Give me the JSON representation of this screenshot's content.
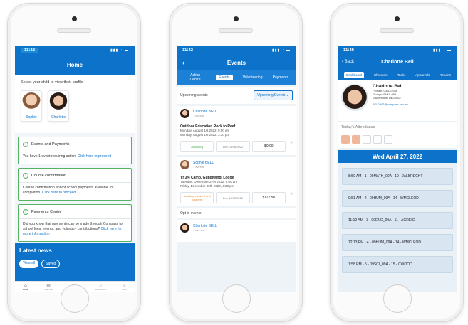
{
  "phone1": {
    "status_time": "11:42",
    "status_icons": "▮▮▮ ◔ ▬",
    "title": "Home",
    "select_label": "Select your child to view their profile",
    "children": [
      {
        "name": "Sophie"
      },
      {
        "name": "Charlotte"
      }
    ],
    "cards": [
      {
        "title": "Events and Payments",
        "text": "You have 1 event requiring action.",
        "link": "Click here to proceed"
      },
      {
        "title": "Course confirmation",
        "text": "Course confirmation and/or school payments available for completion.",
        "link": "Click here to proceed"
      },
      {
        "title": "Payments Centre",
        "text": "Did you know that payments can be made through Compass for school fees, events, and voluntary contributions?",
        "link": "Click here for more information"
      }
    ],
    "news_title": "Latest news",
    "news_filters": [
      "View all",
      "Saved"
    ],
    "tabbar": [
      {
        "label": "Home",
        "icon": "home-icon",
        "glyph": "⌂"
      },
      {
        "label": "Calendar",
        "icon": "calendar-icon",
        "glyph": "▦"
      },
      {
        "label": "Dashboard",
        "icon": "compass-icon",
        "glyph": "◉"
      },
      {
        "label": "Notifications",
        "icon": "bell-icon",
        "glyph": "♫"
      },
      {
        "label": "More",
        "icon": "menu-icon",
        "glyph": "≡"
      }
    ]
  },
  "phone2": {
    "status_time": "11:42",
    "status_icons": "▮▮▮ ◔ ▬",
    "title": "Events",
    "back_glyph": "‹",
    "tabs": [
      "Action Centre",
      "Events",
      "Volunteering",
      "Payments"
    ],
    "upcoming_label": "Upcoming events",
    "filter_value": "Upcoming Events",
    "events": [
      {
        "student": "Charlotte BELL",
        "count": "1 events",
        "title": "Outdoor Education Rock to Reef",
        "start": "Monday, August 1st 2022, 9:00 am",
        "end": "Monday, August 1st 2022, 3:30 pm",
        "status": "Attending",
        "due": "Due 01/08/2022",
        "amount": "$0.00"
      },
      {
        "student": "Sophie BELL",
        "count": "1 events",
        "title": "Yr 3/4 Camp, Gundiwindi Lodge",
        "start": "Tuesday, December 27th 2022, 9:00 am",
        "end": "Friday, December 30th 2022, 4:30 pm",
        "status": "Awaiting consent and payment",
        "due": "Due 14/12/2022",
        "amount": "$112.50"
      }
    ],
    "optin_label": "Opt in events",
    "optin_student": "Charlotte BELL",
    "optin_count": "1 events"
  },
  "phone3": {
    "status_time": "11:46",
    "status_icons": "▮▮▮ ◔ ▬",
    "title": "Charlotte Bell",
    "back_label": "‹ Back",
    "tabs": [
      "Dashboard",
      "Chronicle",
      "Tasks",
      "Approvals",
      "Reports"
    ],
    "profile": {
      "name": "Charlotte Bell",
      "line1": "Female, 03/11/2006",
      "line2": "Groups: EMU, 09A",
      "line3": "Student IDs: BEL0002",
      "email": "BEL0002@compass.edu.au"
    },
    "attendance_label": "Today's Attendance",
    "attendance_filled": 2,
    "attendance_total": 5,
    "date": "Wed April 27, 2022",
    "periods": [
      "8:50 AM - 1 - 09MATH_09A - 10 - JALBRECHT",
      "9:51 AM - 2 - 09HUM_09A - 14 - WMCLEOD",
      "11:12 AM - 3 - 09ENG_09A - 11 - AGREIG",
      "12:13 PM - 4 - 09HUM_09A - 14 - WMCLEOD",
      "1:58 PM - 5 - 09SCI_09A - 15 - CWOOD"
    ]
  },
  "colors": {
    "brand_blue": "#0d72c9",
    "accent_green": "#52b360",
    "warn_orange": "#e58a30"
  }
}
